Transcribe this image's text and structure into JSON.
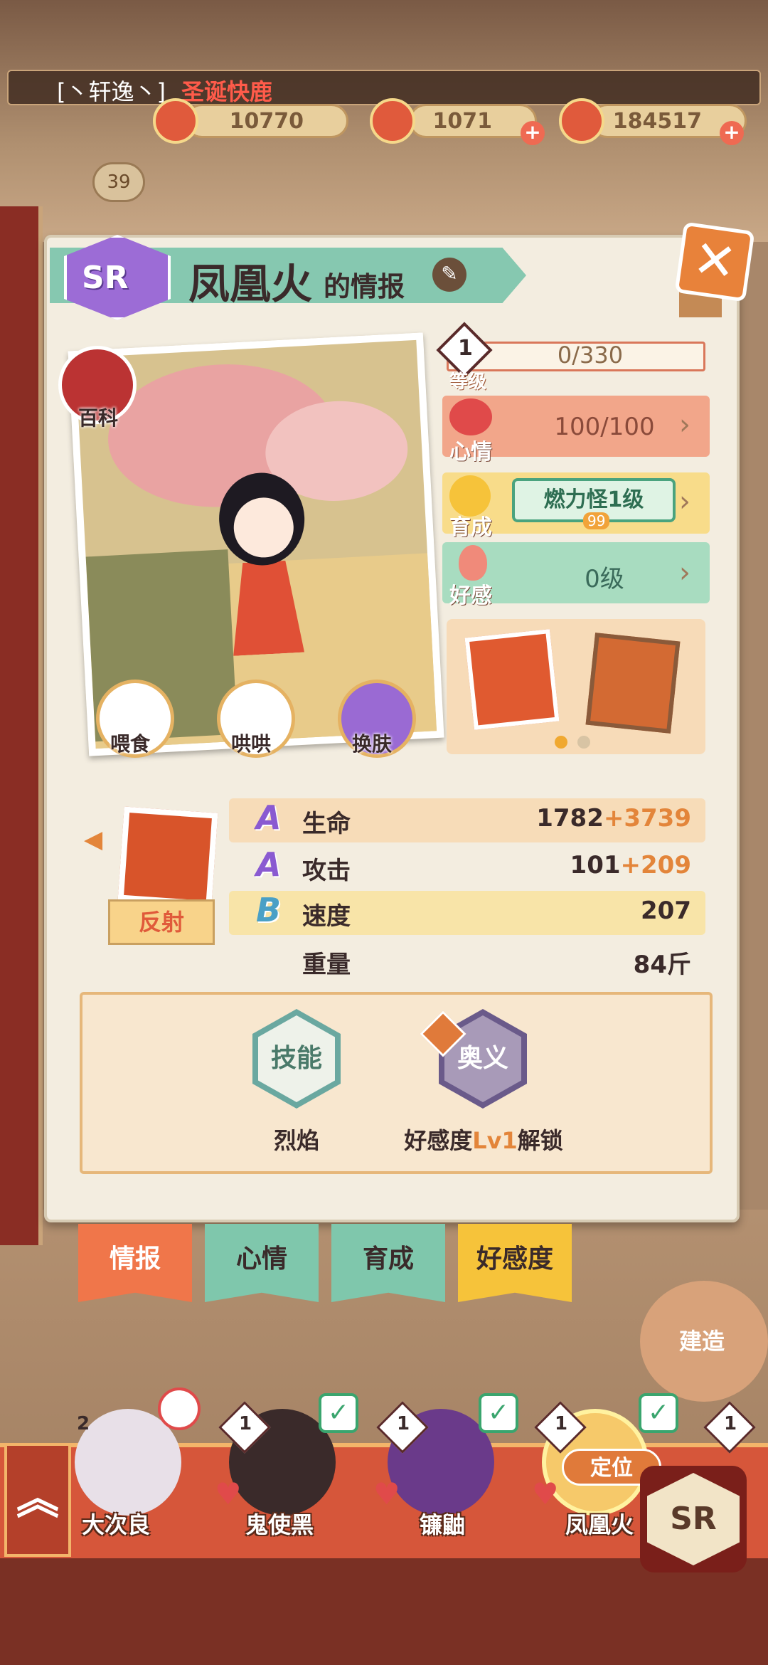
{
  "topbar": {
    "name_prefix": "[丶轩逸丶]",
    "name_title": "圣诞快鹿"
  },
  "resources": [
    {
      "value": "10770"
    },
    {
      "value": "1071"
    },
    {
      "value": "184517"
    }
  ],
  "town_level": "39",
  "panel": {
    "rarity": "SR",
    "title": "凤凰火",
    "title_suffix": "的情报"
  },
  "buttons": {
    "baike": "百科",
    "feed": "喂食",
    "coax": "哄哄",
    "skin": "换肤"
  },
  "level": {
    "badge": "1",
    "label": "等级",
    "value": "0/330"
  },
  "mood": {
    "label": "心情",
    "value": "100/100"
  },
  "growth": {
    "label": "育成",
    "chip": "燃力怪1级",
    "chip_sub": "99"
  },
  "favor": {
    "label": "好感",
    "value": "0级"
  },
  "stats": [
    {
      "grade": "A",
      "name": "生命",
      "base": "1782",
      "bonus": "+3739"
    },
    {
      "grade": "A",
      "name": "攻击",
      "base": "101",
      "bonus": "+209"
    },
    {
      "grade": "B",
      "name": "速度",
      "base": "207",
      "bonus": ""
    },
    {
      "grade": "",
      "name": "重量",
      "base": "84斤",
      "bonus": ""
    }
  ],
  "passive": {
    "label": "反射"
  },
  "skills": {
    "skill_hex": "技能",
    "skill_name": "烈焰",
    "ougi_hex": "奥义",
    "ougi_prefix": "好感度",
    "ougi_lv": "Lv1",
    "ougi_suffix": "解锁"
  },
  "tabs": [
    "情报",
    "心情",
    "育成",
    "好感度"
  ],
  "build_label": "建造",
  "roster": [
    {
      "level": "2",
      "name": "大次良"
    },
    {
      "level": "1",
      "name": "鬼使黑"
    },
    {
      "level": "1",
      "name": "镰鼬"
    },
    {
      "level": "1",
      "name": "凤凰火"
    },
    {
      "level": "1",
      "name": ""
    }
  ],
  "locate_label": "定位",
  "sr_button": "SR",
  "colors": {
    "accent": "#e3853a",
    "sr": "#9c6cd6",
    "mood": "#f2a68a",
    "growth": "#f8dc8a",
    "favor": "#a8dcc0"
  }
}
